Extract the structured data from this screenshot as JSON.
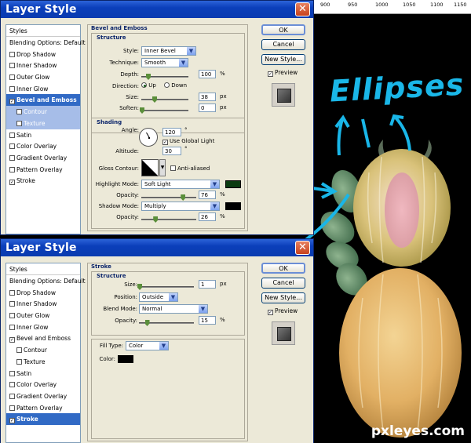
{
  "dialog1": {
    "title": "Layer Style",
    "styles_header": "Styles",
    "styles": [
      {
        "label": "Blending Options: Default",
        "checkbox": false,
        "checked": false,
        "state": "normal"
      },
      {
        "label": "Drop Shadow",
        "checkbox": true,
        "checked": false,
        "state": "normal"
      },
      {
        "label": "Inner Shadow",
        "checkbox": true,
        "checked": false,
        "state": "normal"
      },
      {
        "label": "Outer Glow",
        "checkbox": true,
        "checked": false,
        "state": "normal"
      },
      {
        "label": "Inner Glow",
        "checkbox": true,
        "checked": false,
        "state": "normal"
      },
      {
        "label": "Bevel and Emboss",
        "checkbox": true,
        "checked": true,
        "state": "selected"
      },
      {
        "label": "Contour",
        "checkbox": true,
        "checked": false,
        "state": "subsel",
        "indent": true
      },
      {
        "label": "Texture",
        "checkbox": true,
        "checked": false,
        "state": "subsel",
        "indent": true
      },
      {
        "label": "Satin",
        "checkbox": true,
        "checked": false,
        "state": "normal"
      },
      {
        "label": "Color Overlay",
        "checkbox": true,
        "checked": false,
        "state": "normal"
      },
      {
        "label": "Gradient Overlay",
        "checkbox": true,
        "checked": false,
        "state": "normal"
      },
      {
        "label": "Pattern Overlay",
        "checkbox": true,
        "checked": false,
        "state": "normal"
      },
      {
        "label": "Stroke",
        "checkbox": true,
        "checked": true,
        "state": "normal"
      }
    ],
    "section_title": "Bevel and Emboss",
    "structure_title": "Structure",
    "style_label": "Style:",
    "style_value": "Inner Bevel",
    "technique_label": "Technique:",
    "technique_value": "Smooth",
    "depth_label": "Depth:",
    "depth_value": "100",
    "depth_unit": "%",
    "direction_label": "Direction:",
    "dir_up": "Up",
    "dir_down": "Down",
    "size_label": "Size:",
    "size_value": "38",
    "size_unit": "px",
    "soften_label": "Soften:",
    "soften_value": "0",
    "soften_unit": "px",
    "shading_title": "Shading",
    "angle_label": "Angle:",
    "angle_value": "120",
    "angle_unit": "°",
    "global_light": "Use Global Light",
    "altitude_label": "Altitude:",
    "altitude_value": "30",
    "altitude_unit": "°",
    "gloss_label": "Gloss Contour:",
    "anti_aliased": "Anti-aliased",
    "highlight_label": "Highlight Mode:",
    "highlight_value": "Soft Light",
    "highlight_color": "#0b3b10",
    "opacity1_label": "Opacity:",
    "opacity1_value": "76",
    "opacity1_unit": "%",
    "shadow_label": "Shadow Mode:",
    "shadow_value": "Multiply",
    "shadow_color": "#000000",
    "opacity2_label": "Opacity:",
    "opacity2_value": "26",
    "opacity2_unit": "%",
    "ok": "OK",
    "cancel": "Cancel",
    "new_style": "New Style...",
    "preview": "Preview"
  },
  "dialog2": {
    "title": "Layer Style",
    "styles_header": "Styles",
    "styles": [
      {
        "label": "Blending Options: Default",
        "checkbox": false,
        "checked": false,
        "state": "normal"
      },
      {
        "label": "Drop Shadow",
        "checkbox": true,
        "checked": false,
        "state": "normal"
      },
      {
        "label": "Inner Shadow",
        "checkbox": true,
        "checked": false,
        "state": "normal"
      },
      {
        "label": "Outer Glow",
        "checkbox": true,
        "checked": false,
        "state": "normal"
      },
      {
        "label": "Inner Glow",
        "checkbox": true,
        "checked": false,
        "state": "normal"
      },
      {
        "label": "Bevel and Emboss",
        "checkbox": true,
        "checked": true,
        "state": "normal"
      },
      {
        "label": "Contour",
        "checkbox": true,
        "checked": false,
        "state": "normal",
        "indent": true
      },
      {
        "label": "Texture",
        "checkbox": true,
        "checked": false,
        "state": "normal",
        "indent": true
      },
      {
        "label": "Satin",
        "checkbox": true,
        "checked": false,
        "state": "normal"
      },
      {
        "label": "Color Overlay",
        "checkbox": true,
        "checked": false,
        "state": "normal"
      },
      {
        "label": "Gradient Overlay",
        "checkbox": true,
        "checked": false,
        "state": "normal"
      },
      {
        "label": "Pattern Overlay",
        "checkbox": true,
        "checked": false,
        "state": "normal"
      },
      {
        "label": "Stroke",
        "checkbox": true,
        "checked": true,
        "state": "selected"
      }
    ],
    "section_title": "Stroke",
    "structure_title": "Structure",
    "size_label": "Size:",
    "size_value": "1",
    "size_unit": "px",
    "position_label": "Position:",
    "position_value": "Outside",
    "blend_label": "Blend Mode:",
    "blend_value": "Normal",
    "opacity_label": "Opacity:",
    "opacity_value": "15",
    "opacity_unit": "%",
    "fill_type_label": "Fill Type:",
    "fill_type_value": "Color",
    "color_label": "Color:",
    "stroke_color": "#000000",
    "ok": "OK",
    "cancel": "Cancel",
    "new_style": "New Style...",
    "preview": "Preview"
  },
  "ruler": {
    "ticks": [
      "900",
      "950",
      "1000",
      "1050",
      "1100",
      "1150"
    ]
  },
  "annotation": "Ellipses",
  "watermark": "pxleyes.com"
}
